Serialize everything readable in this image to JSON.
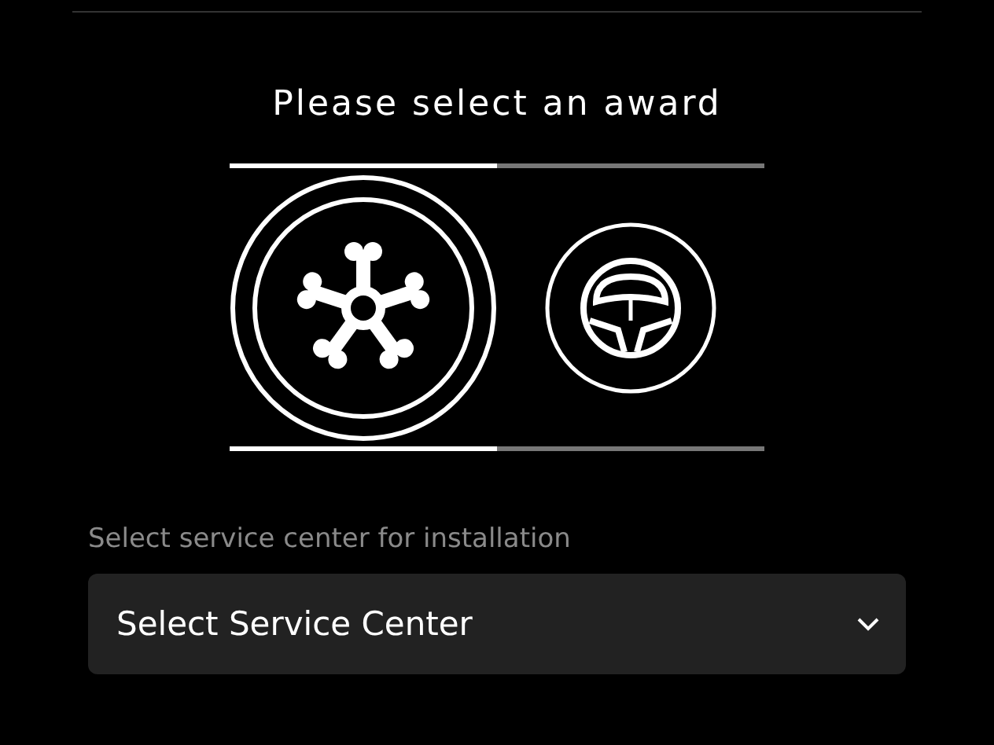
{
  "title": "Please select an award",
  "progress": {
    "level": 0.5
  },
  "awards": [
    {
      "kind": "wheels",
      "selected": true
    },
    {
      "kind": "steering-wheel",
      "selected": false
    }
  ],
  "service_center": {
    "label": "Select service center for installation",
    "value": "Select Service Center"
  }
}
